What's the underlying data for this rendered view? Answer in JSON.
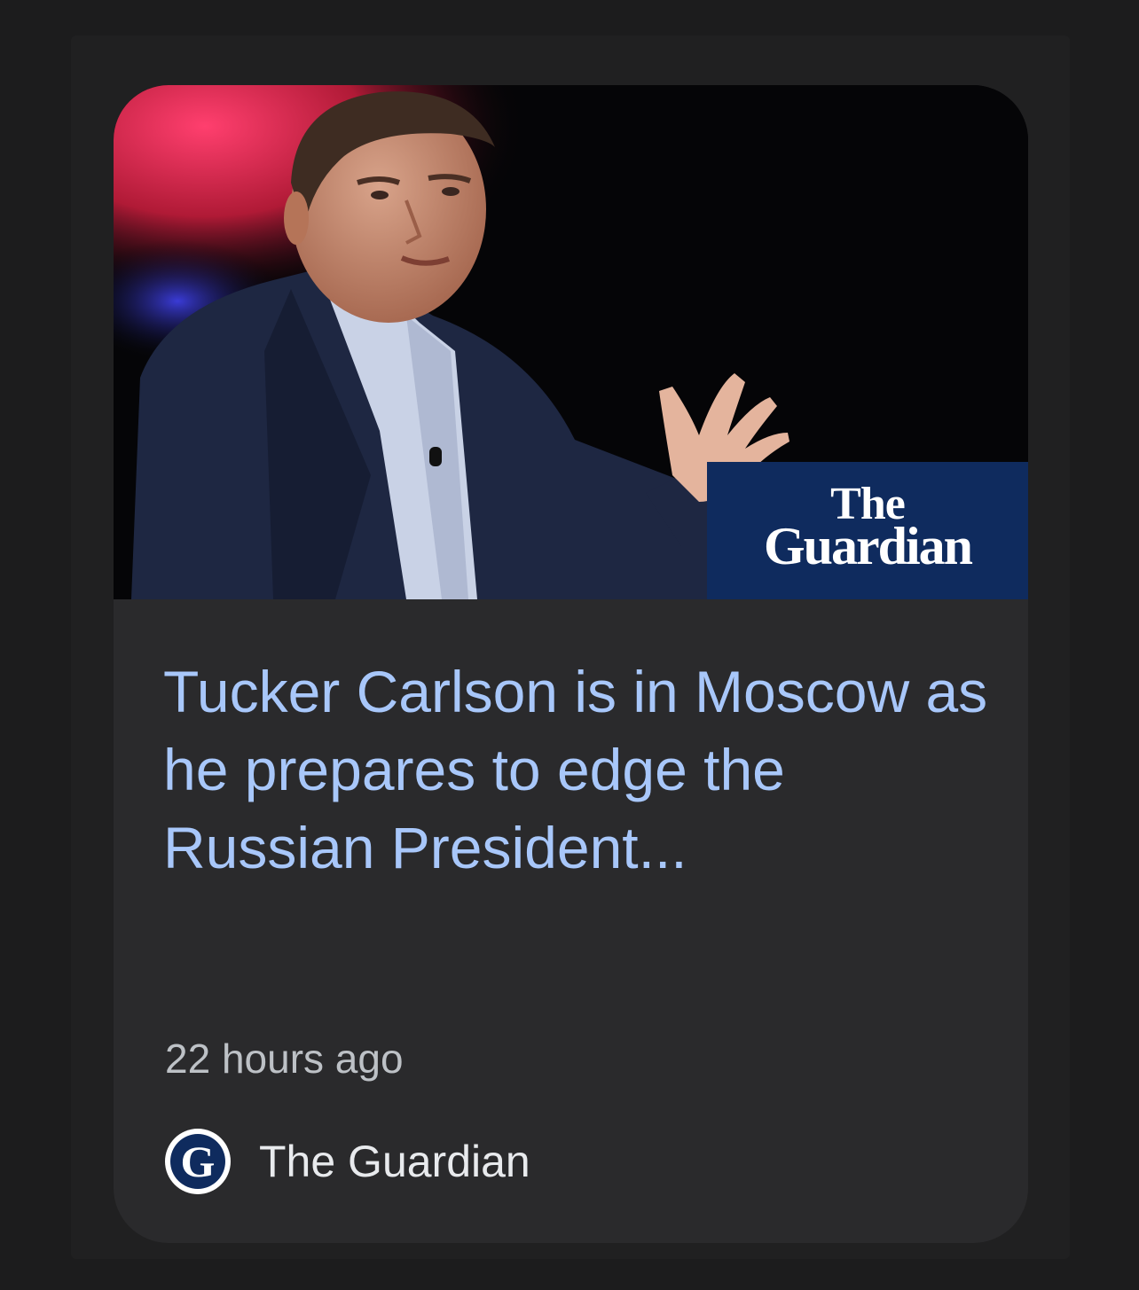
{
  "card": {
    "image": {
      "alt": "Tucker Carlson speaking on stage",
      "logo_line1": "The",
      "logo_line2": "Guardian",
      "logo_color": "#0f2b5e"
    },
    "headline": "Tucker Carlson is in Moscow as he prepares to edge the Russian President...",
    "time": "22 hours ago",
    "source": {
      "icon_letter": "G",
      "icon": "guardian-logo-icon",
      "name": "The Guardian"
    }
  },
  "colors": {
    "page_bg": "#1c1c1d",
    "card_bg": "#2a2a2c",
    "headline": "#a8c7fa",
    "meta": "#bdc1c6"
  }
}
